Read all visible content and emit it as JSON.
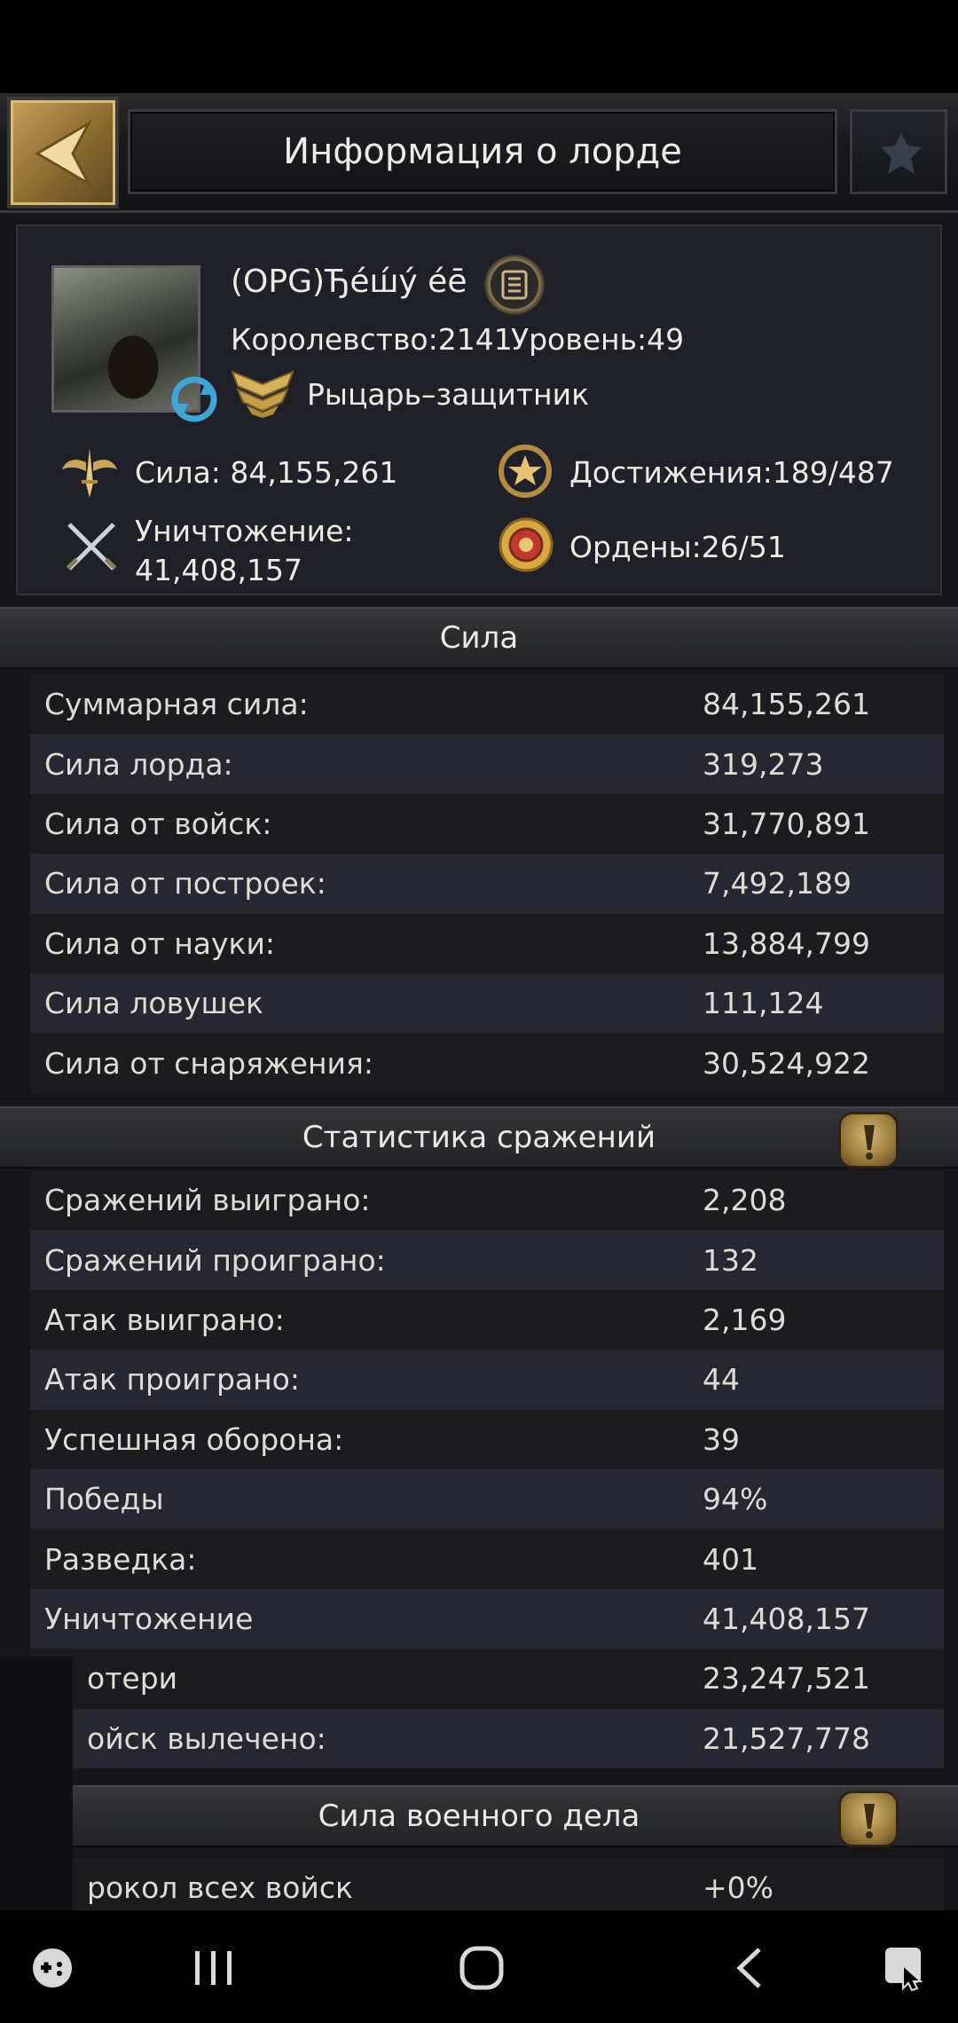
{
  "header": {
    "title": "Информация о лорде"
  },
  "profile": {
    "name": "(OPG)Ђе́ш́у́ е́ē",
    "kingdom": "Королевство:2141",
    "level": "Уровень:49",
    "rank": "Рыцарь–защитник",
    "power": "Сила: 84,155,261",
    "achievements": "Достижения:189/487",
    "destruction_label": "Уничтожение:",
    "destruction_value": "41,408,157",
    "orders": "Ордены:26/51"
  },
  "sections": {
    "power": {
      "title": "Сила",
      "rows": [
        {
          "label": "Суммарная сила:",
          "value": "84,155,261"
        },
        {
          "label": "Сила лорда:",
          "value": "319,273"
        },
        {
          "label": "Сила от войск:",
          "value": "31,770,891"
        },
        {
          "label": "Сила от построек:",
          "value": "7,492,189"
        },
        {
          "label": "Сила от науки:",
          "value": "13,884,799"
        },
        {
          "label": "Сила ловушек",
          "value": "111,124"
        },
        {
          "label": "Сила от снаряжения:",
          "value": "30,524,922"
        }
      ]
    },
    "battle": {
      "title": "Статистика сражений",
      "rows": [
        {
          "label": "Сражений выиграно:",
          "value": "2,208"
        },
        {
          "label": "Сражений проиграно:",
          "value": "132"
        },
        {
          "label": "Атак выиграно:",
          "value": "2,169"
        },
        {
          "label": "Атак проиграно:",
          "value": "44"
        },
        {
          "label": "Успешная оборона:",
          "value": "39"
        },
        {
          "label": "Победы",
          "value": "94%"
        },
        {
          "label": "Разведка:",
          "value": "401"
        },
        {
          "label": "Уничтожение",
          "value": "41,408,157"
        },
        {
          "label": "отери",
          "value": "23,247,521"
        },
        {
          "label": "ойск вылечено:",
          "value": "21,527,778"
        }
      ]
    },
    "military": {
      "title": "Сила военного дела",
      "rows": [
        {
          "label": "рокол всех войск",
          "value": "+0%"
        }
      ]
    }
  },
  "icons": {
    "back": "chevron-left-icon",
    "scroll": "scroll-icon",
    "refresh": "refresh-icon",
    "rank": "chevron-badge-icon",
    "power": "sword-wings-icon",
    "achievements": "star-laurel-icon",
    "destruction": "crossed-swords-icon",
    "orders": "medal-icon",
    "info": "exclamation-icon"
  },
  "colors": {
    "accent_gold": "#c7a05a",
    "background": "#16161a",
    "text": "#dedcd6"
  }
}
